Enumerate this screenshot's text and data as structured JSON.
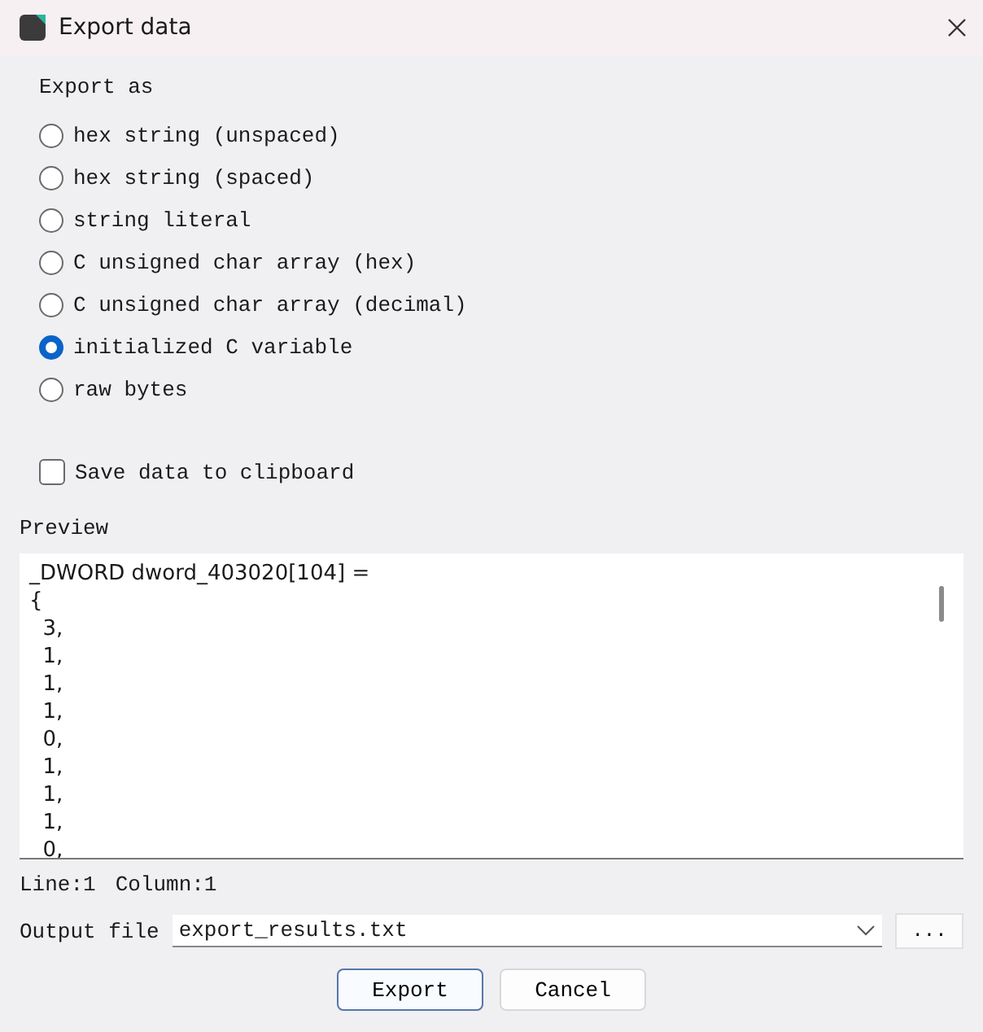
{
  "window": {
    "title": "Export data"
  },
  "export_as": {
    "label": "Export as",
    "options": [
      {
        "label": "hex string (unspaced)",
        "selected": false
      },
      {
        "label": "hex string (spaced)",
        "selected": false
      },
      {
        "label": "string literal",
        "selected": false
      },
      {
        "label": "C unsigned char array (hex)",
        "selected": false
      },
      {
        "label": "C unsigned char array (decimal)",
        "selected": false
      },
      {
        "label": "initialized C variable",
        "selected": true
      },
      {
        "label": "raw bytes",
        "selected": false
      }
    ]
  },
  "save_to_clipboard": {
    "label": "Save data to clipboard",
    "checked": false
  },
  "preview": {
    "label": "Preview",
    "lines": [
      "_DWORD dword_403020[104] =",
      "{",
      "  3,",
      "  1,",
      "  1,",
      "  1,",
      "  0,",
      "  1,",
      "  1,",
      "  1,",
      "  0,"
    ]
  },
  "status": [
    "Line:1",
    "Column:1"
  ],
  "output_file": {
    "label": "Output file",
    "value": "export_results.txt",
    "browse": "..."
  },
  "buttons": [
    {
      "label": "Export",
      "default": true
    },
    {
      "label": "Cancel",
      "default": false
    }
  ]
}
